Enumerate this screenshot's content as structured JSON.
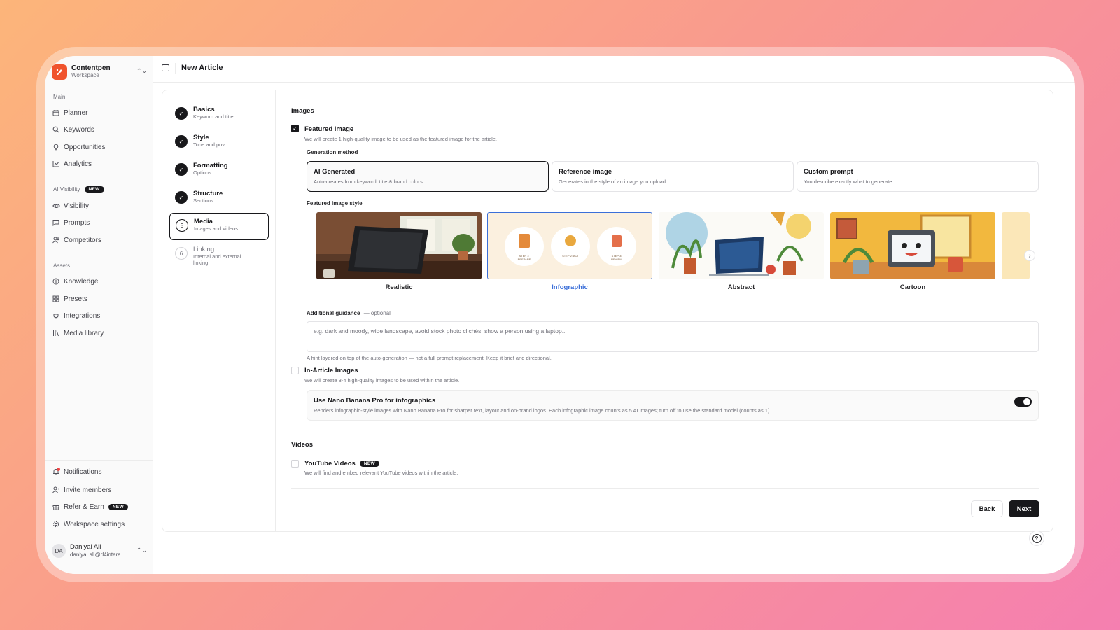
{
  "workspace": {
    "name": "Contentpen",
    "sub": "Workspace"
  },
  "header": {
    "title": "New Article"
  },
  "sidebar": {
    "main_label": "Main",
    "main_items": [
      {
        "label": "Planner",
        "icon": "calendar-icon"
      },
      {
        "label": "Keywords",
        "icon": "search-icon"
      },
      {
        "label": "Opportunities",
        "icon": "lightbulb-icon"
      },
      {
        "label": "Analytics",
        "icon": "chart-icon"
      }
    ],
    "ai_label": "AI Visibility",
    "ai_badge": "NEW",
    "ai_items": [
      {
        "label": "Visibility",
        "icon": "eye-icon"
      },
      {
        "label": "Prompts",
        "icon": "message-icon"
      },
      {
        "label": "Competitors",
        "icon": "users-icon"
      }
    ],
    "assets_label": "Assets",
    "assets_items": [
      {
        "label": "Knowledge",
        "icon": "book-icon"
      },
      {
        "label": "Presets",
        "icon": "grid-icon"
      },
      {
        "label": "Integrations",
        "icon": "plug-icon"
      },
      {
        "label": "Media library",
        "icon": "library-icon"
      }
    ],
    "bottom_items": [
      {
        "label": "Notifications",
        "icon": "bell-icon"
      },
      {
        "label": "Invite members",
        "icon": "user-plus-icon"
      },
      {
        "label": "Refer & Earn",
        "icon": "gift-icon",
        "badge": "NEW"
      },
      {
        "label": "Workspace settings",
        "icon": "gear-icon"
      }
    ],
    "user": {
      "initials": "DA",
      "name": "Danlyal Ali",
      "email": "danlyal.ali@d4intera..."
    }
  },
  "steps": [
    {
      "title": "Basics",
      "sub": "Keyword and title",
      "state": "done"
    },
    {
      "title": "Style",
      "sub": "Tone and pov",
      "state": "done"
    },
    {
      "title": "Formatting",
      "sub": "Options",
      "state": "done"
    },
    {
      "title": "Structure",
      "sub": "Sections",
      "state": "done"
    },
    {
      "title": "Media",
      "sub": "Images and videos",
      "state": "current",
      "num": "5"
    },
    {
      "title": "Linking",
      "sub": "Internal and external linking",
      "state": "todo",
      "num": "6"
    }
  ],
  "images": {
    "heading": "Images",
    "featured": {
      "title": "Featured Image",
      "desc": "We will create 1 high-quality image to be used as the featured image for the article.",
      "checked": true
    },
    "gen_label": "Generation method",
    "methods": [
      {
        "title": "AI Generated",
        "desc": "Auto-creates from keyword, title & brand colors",
        "selected": true
      },
      {
        "title": "Reference image",
        "desc": "Generates in the style of an image you upload",
        "selected": false
      },
      {
        "title": "Custom prompt",
        "desc": "You describe exactly what to generate",
        "selected": false
      }
    ],
    "style_label": "Featured image style",
    "styles": [
      {
        "label": "Realistic",
        "selected": false
      },
      {
        "label": "Infographic",
        "selected": true
      },
      {
        "label": "Abstract",
        "selected": false
      },
      {
        "label": "Cartoon",
        "selected": false
      }
    ],
    "infographic_steps": [
      "STEP 1: PREPARE",
      "STEP 2: ACT",
      "STEP 3: REVIEW"
    ],
    "guidance_label": "Additional guidance",
    "guidance_optional": "— optional",
    "guidance_placeholder": "e.g. dark and moody, wide landscape, avoid stock photo clichés, show a person using a laptop...",
    "guidance_hint": "A hint layered on top of the auto-generation — not a full prompt replacement. Keep it brief and directional.",
    "in_article": {
      "title": "In-Article Images",
      "desc": "We will create 3-4 high-quality images to be used within the article.",
      "checked": false
    },
    "nano": {
      "title": "Use Nano Banana Pro for infographics",
      "desc": "Renders infographic-style images with Nano Banana Pro for sharper text, layout and on-brand logos. Each infographic image counts as 5 AI images; turn off to use the standard model (counts as 1).",
      "on": true
    }
  },
  "videos": {
    "heading": "Videos",
    "youtube": {
      "title": "YouTube Videos",
      "badge": "NEW",
      "desc": "We will find and embed relevant YouTube videos within the article.",
      "checked": false
    }
  },
  "buttons": {
    "back": "Back",
    "next": "Next"
  },
  "colors": {
    "accent": "#18181b",
    "selected_style": "#3b6fd9",
    "logo": "#f0532d",
    "notification": "#ef4444"
  }
}
